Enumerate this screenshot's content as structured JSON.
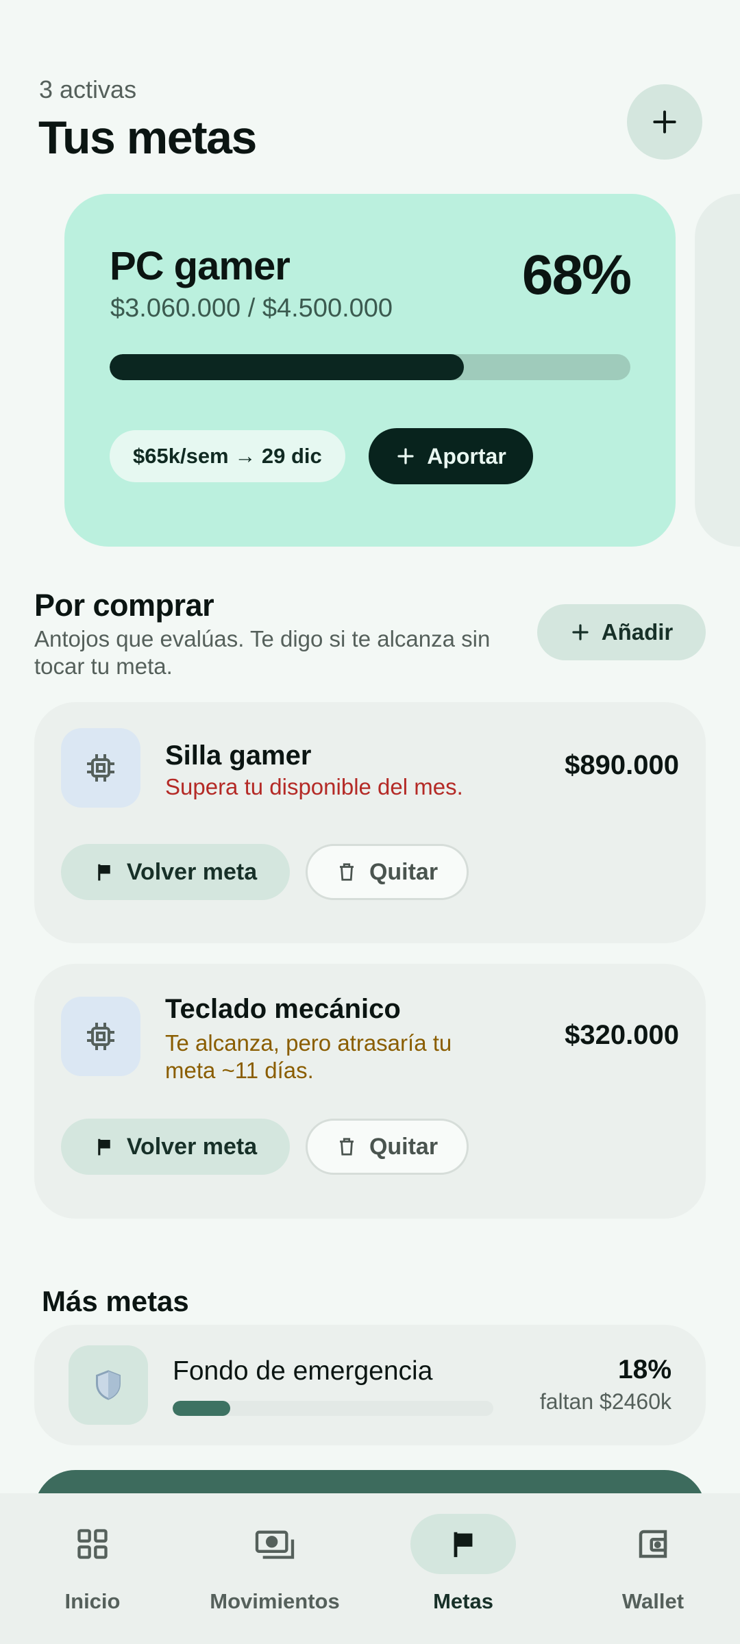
{
  "header": {
    "subtitle": "3 activas",
    "title": "Tus metas"
  },
  "featured_goal": {
    "name": "PC gamer",
    "amount": "$3.060.000 / $4.500.000",
    "percent_label": "68%",
    "progress": 0.68,
    "pace": "$65k/sem → 29 dic",
    "contribute_label": "Aportar"
  },
  "to_buy": {
    "title": "Por comprar",
    "description": "Antojos que evalúas. Te digo si te alcanza sin tocar tu meta.",
    "add_label": "Añadir",
    "items": [
      {
        "name": "Silla gamer",
        "message": "Supera tu disponible del mes.",
        "price": "$890.000",
        "goal_label": "Volver meta",
        "remove_label": "Quitar"
      },
      {
        "name": "Teclado mecánico",
        "message": "Te alcanza, pero atrasaría tu meta ~11 días.",
        "price": "$320.000",
        "goal_label": "Volver meta",
        "remove_label": "Quitar"
      }
    ]
  },
  "more_goals": {
    "title": "Más metas",
    "items": [
      {
        "name": "Fondo de emergencia",
        "percent_label": "18%",
        "progress": 0.18,
        "remaining": "faltan $2460k"
      }
    ]
  },
  "nav": {
    "items": [
      {
        "label": "Inicio",
        "icon": "grid-icon"
      },
      {
        "label": "Movimientos",
        "icon": "money-icon"
      },
      {
        "label": "Metas",
        "icon": "flag-icon",
        "active": true
      },
      {
        "label": "Wallet",
        "icon": "wallet-icon"
      }
    ]
  }
}
